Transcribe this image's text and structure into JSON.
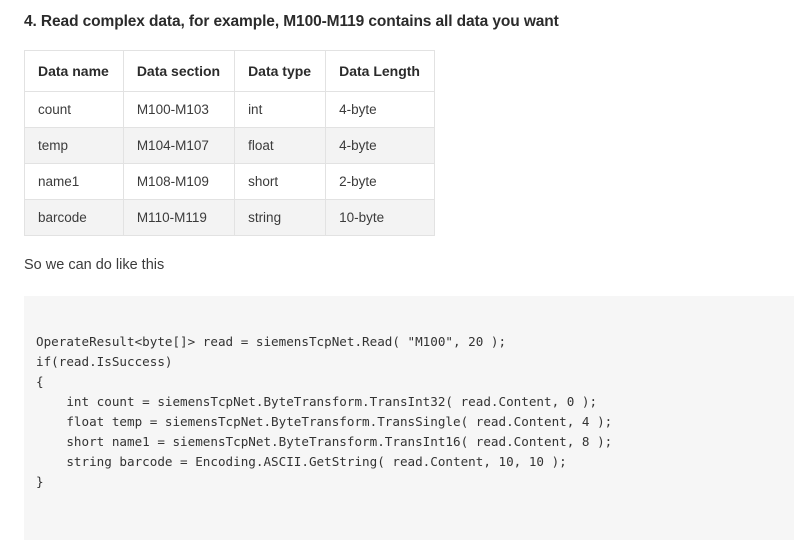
{
  "heading": "4. Read complex data, for example, M100-M119 contains all data you want",
  "table": {
    "columns": [
      "Data name",
      "Data section",
      "Data type",
      "Data Length"
    ],
    "rows": [
      {
        "name": "count",
        "section": "M100-M103",
        "type": "int",
        "length": "4-byte"
      },
      {
        "name": "temp",
        "section": "M104-M107",
        "type": "float",
        "length": "4-byte"
      },
      {
        "name": "name1",
        "section": "M108-M109",
        "type": "short",
        "length": "2-byte"
      },
      {
        "name": "barcode",
        "section": "M110-M119",
        "type": "string",
        "length": "10-byte"
      }
    ]
  },
  "paragraph": "So we can do like this",
  "code": {
    "language": "csharp",
    "text": "OperateResult<byte[]> read = siemensTcpNet.Read( \"M100\", 20 );\nif(read.IsSuccess)\n{\n    int count = siemensTcpNet.ByteTransform.TransInt32( read.Content, 0 );\n    float temp = siemensTcpNet.ByteTransform.TransSingle( read.Content, 4 );\n    short name1 = siemensTcpNet.ByteTransform.TransInt16( read.Content, 8 );\n    string barcode = Encoding.ASCII.GetString( read.Content, 10, 10 );\n}",
    "lines": [
      "OperateResult<byte[]> read = siemensTcpNet.Read( \"M100\", 20 );",
      "if(read.IsSuccess)",
      "{",
      "    int count = siemensTcpNet.ByteTransform.TransInt32( read.Content, 0 );",
      "    float temp = siemensTcpNet.ByteTransform.TransSingle( read.Content, 4 );",
      "    short name1 = siemensTcpNet.ByteTransform.TransInt16( read.Content, 8 );",
      "    string barcode = Encoding.ASCII.GetString( read.Content, 10, 10 );",
      "}"
    ]
  },
  "colors": {
    "page_background": "#ffffff",
    "text": "#3b3b3b",
    "heading": "#2b2b2b",
    "table_border": "#e2e2e2",
    "table_stripe": "#f3f3f3",
    "code_background": "#f6f6f6",
    "code_text": "#333333"
  }
}
